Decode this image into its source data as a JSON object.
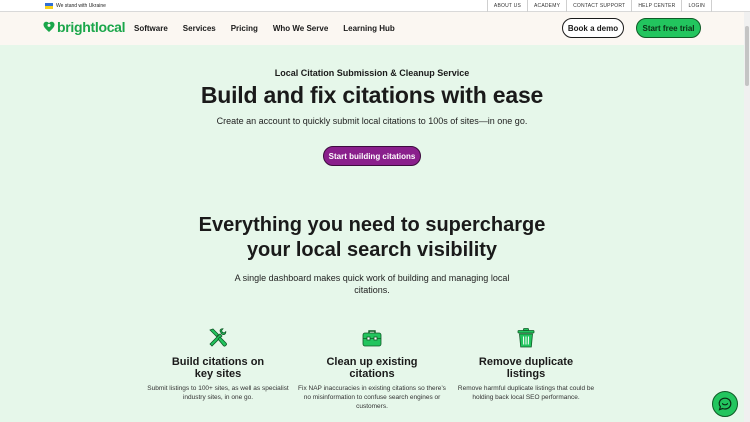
{
  "utility": {
    "ukraine_text": "We stand with Ukraine",
    "links": [
      "ABOUT US",
      "ACADEMY",
      "CONTACT SUPPORT",
      "HELP CENTER",
      "LOGIN"
    ]
  },
  "nav": {
    "logo_text": "brightlocal",
    "links": [
      "Software",
      "Services",
      "Pricing",
      "Who We Serve",
      "Learning Hub"
    ],
    "demo_label": "Book a demo",
    "trial_label": "Start free trial"
  },
  "hero": {
    "eyebrow": "Local Citation Submission & Cleanup Service",
    "title": "Build and fix citations with ease",
    "subtitle": "Create an account to quickly submit local citations to 100s of sites—in one go.",
    "cta_label": "Start building citations"
  },
  "section": {
    "title_line1": "Everything you need to supercharge",
    "title_line2": "your local search visibility",
    "subtitle": "A single dashboard makes quick work of building and managing local citations."
  },
  "features": [
    {
      "icon": "tools-icon",
      "title_line1": "Build citations on",
      "title_line2": "key sites",
      "desc": "Submit listings to 100+ sites, as well as specialist industry sites, in one go."
    },
    {
      "icon": "toolbox-icon",
      "title_line1": "Clean up existing",
      "title_line2": "citations",
      "desc": "Fix NAP inaccuracies in existing citations so there’s no misinformation to confuse search engines or customers."
    },
    {
      "icon": "trash-icon",
      "title_line1": "Remove duplicate",
      "title_line2": "listings",
      "desc": "Remove harmful duplicate listings that could be holding back local SEO performance."
    }
  ],
  "colors": {
    "brand_green": "#22c55e",
    "logo_green": "#1aa64a",
    "cta_purple": "#8a1f8c",
    "page_bg": "#e6f7ea",
    "nav_bg": "#fbf7f2"
  }
}
